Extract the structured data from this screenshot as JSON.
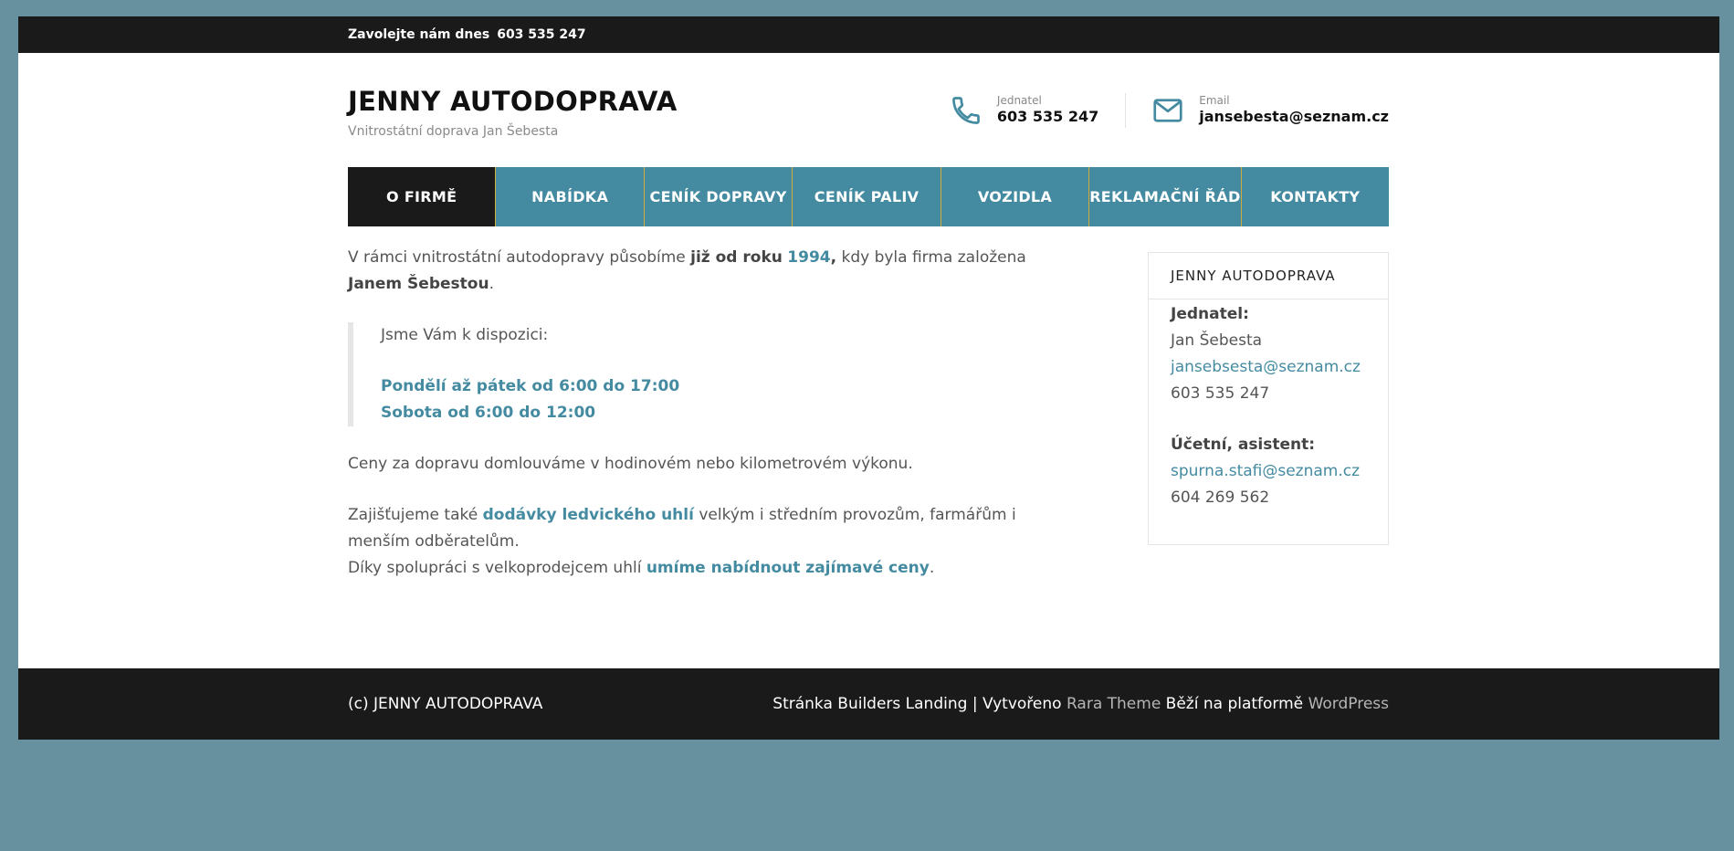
{
  "topbar": {
    "call_label": "Zavolejte nám dnes",
    "phone": "603 535 247"
  },
  "brand": {
    "title": "JENNY AUTODOPRAVA",
    "subtitle": "Vnitrostátní doprava Jan Šebesta"
  },
  "header_contacts": [
    {
      "icon": "phone-icon",
      "label": "Jednatel",
      "value": "603 535 247"
    },
    {
      "icon": "envelope-icon",
      "label": "Email",
      "value": "jansebesta@seznam.cz"
    }
  ],
  "nav": [
    {
      "label": "O FIRMĚ",
      "active": true
    },
    {
      "label": "NABÍDKA"
    },
    {
      "label": "CENÍK DOPRAVY"
    },
    {
      "label": "CENÍK PALIV"
    },
    {
      "label": "VOZIDLA"
    },
    {
      "label": "REKLAMAČNÍ ŘÁD"
    },
    {
      "label": "KONTAKTY"
    }
  ],
  "content": {
    "intro": {
      "t1": "V rámci vnitrostátní autodopravy působíme ",
      "b1": "již od roku",
      "year": "1994",
      "comma": ",",
      "t2": " kdy byla firma založena ",
      "b2": "Janem Šebestou",
      "end": "."
    },
    "quote": {
      "intro": "Jsme Vám k dispozici:",
      "hours1": "Pondělí až pátek od 6:00 do 17:00",
      "hours2": "Sobota od 6:00 do 12:00"
    },
    "prices": "Ceny za dopravu domlouváme v hodinovém nebo kilometrovém výkonu.",
    "coal": {
      "t1": "Zajišťujeme také ",
      "l1": "dodávky ledvického uhlí",
      "t2": " velkým i středním provozům, farmářům i menším odběratelům.",
      "t3": "Díky spolupráci s velkoprodejcem uhlí ",
      "l2": "umíme nabídnout zajímavé ceny",
      "end": "."
    }
  },
  "sidebar": {
    "title": "JENNY AUTODOPRAVA",
    "manager_label": "Jednatel:",
    "manager_name": "Jan Šebesta",
    "manager_email": "jansebsesta@seznam.cz",
    "manager_phone": "603 535 247",
    "assistant_label": "Účetní, asistent:",
    "assistant_email": "spurna.stafi@seznam.cz",
    "assistant_phone": "604 269 562"
  },
  "footer": {
    "copyright": "(c) JENNY AUTODOPRAVA",
    "credit1": "Stránka Builders Landing | Vytvořeno ",
    "theme_link": "Rara Theme",
    "credit2": " Běží na platformě ",
    "wp_link": "WordPress"
  },
  "colors": {
    "accent": "#448ba1",
    "dark": "#1a1a1a",
    "background": "#68919f",
    "nav_divider": "#d4a93a"
  }
}
